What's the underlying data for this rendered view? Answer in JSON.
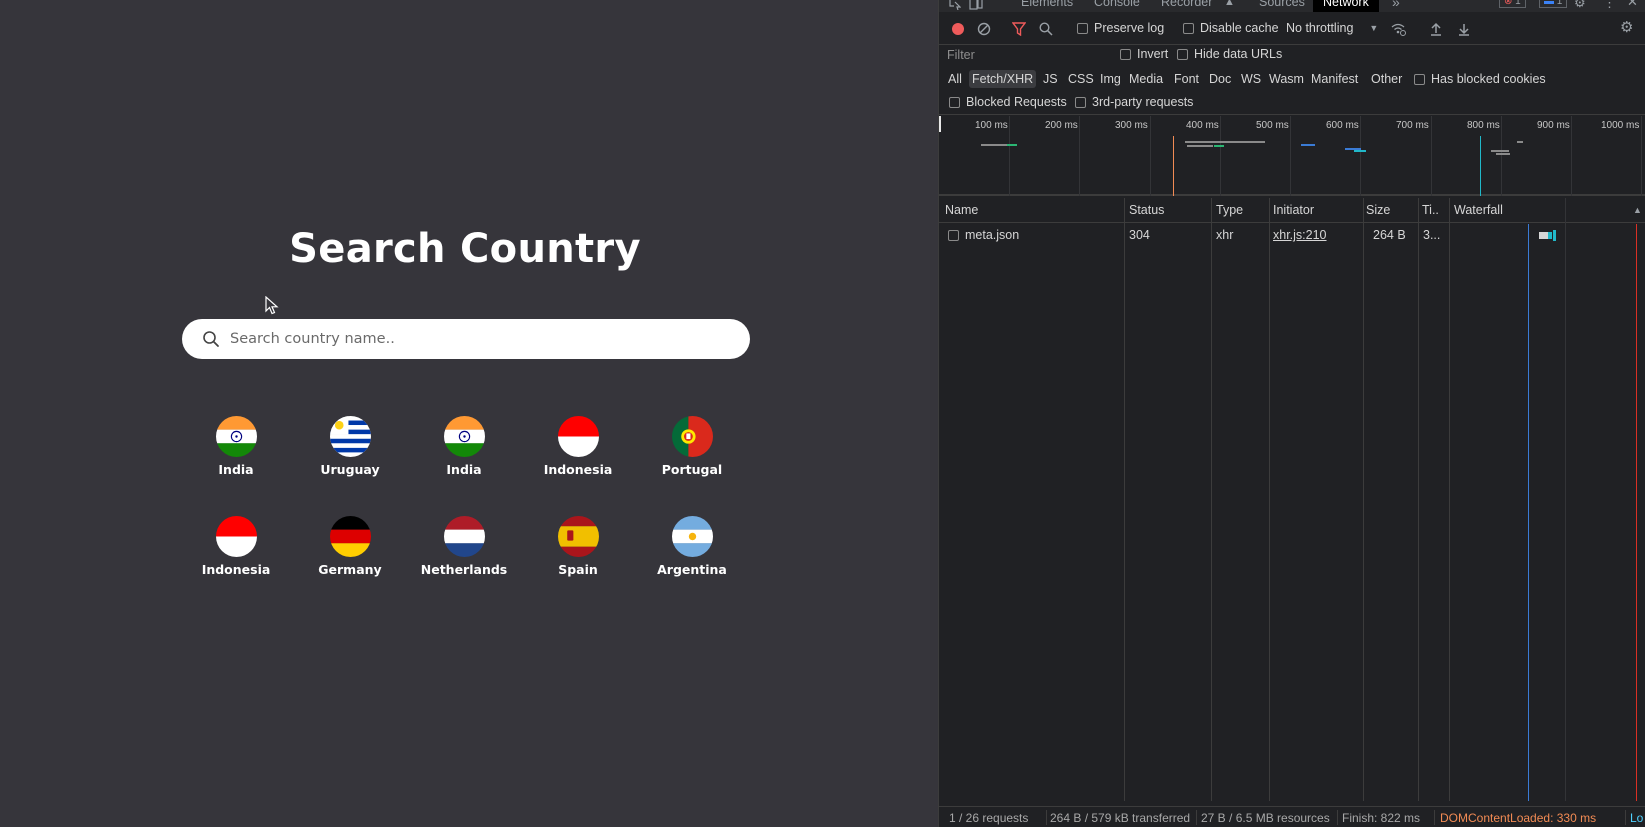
{
  "app": {
    "title": "Search Country",
    "search_placeholder": "Search country name..",
    "countries": [
      {
        "name": "India",
        "flag": "india-flag-icon"
      },
      {
        "name": "Uruguay",
        "flag": "uruguay-flag-icon"
      },
      {
        "name": "India",
        "flag": "india-flag-icon"
      },
      {
        "name": "Indonesia",
        "flag": "indonesia-flag-icon"
      },
      {
        "name": "Portugal",
        "flag": "portugal-flag-icon"
      },
      {
        "name": "Indonesia",
        "flag": "indonesia-flag-icon"
      },
      {
        "name": "Germany",
        "flag": "germany-flag-icon"
      },
      {
        "name": "Netherlands",
        "flag": "netherlands-flag-icon"
      },
      {
        "name": "Spain",
        "flag": "spain-flag-icon"
      },
      {
        "name": "Argentina",
        "flag": "argentina-flag-icon"
      }
    ]
  },
  "devtools": {
    "tabs": [
      "Elements",
      "Console",
      "Recorder",
      "Sources",
      "Network"
    ],
    "active_tab": "Network",
    "error_count": "1",
    "message_count": "1",
    "toolbar": {
      "preserve_log": "Preserve log",
      "disable_cache": "Disable cache",
      "throttling": "No throttling"
    },
    "filter": {
      "placeholder": "Filter",
      "invert": "Invert",
      "hide_data_urls": "Hide data URLs"
    },
    "resource_types": [
      "All",
      "Fetch/XHR",
      "JS",
      "CSS",
      "Img",
      "Media",
      "Font",
      "Doc",
      "WS",
      "Wasm",
      "Manifest",
      "Other"
    ],
    "active_type": "Fetch/XHR",
    "has_blocked_cookies": "Has blocked cookies",
    "blocked_requests": "Blocked Requests",
    "third_party": "3rd-party requests",
    "timeline_ticks": [
      "100 ms",
      "200 ms",
      "300 ms",
      "400 ms",
      "500 ms",
      "600 ms",
      "700 ms",
      "800 ms",
      "900 ms",
      "1000 ms"
    ],
    "columns": [
      "Name",
      "Status",
      "Type",
      "Initiator",
      "Size",
      "Ti..",
      "Waterfall"
    ],
    "requests": [
      {
        "name": "meta.json",
        "status": "304",
        "type": "xhr",
        "initiator": "xhr.js:210",
        "size": "264 B",
        "time": "3..."
      }
    ],
    "status_bar": {
      "requests": "1 / 26 requests",
      "transferred": "264 B / 579 kB transferred",
      "resources": "27 B / 6.5 MB resources",
      "finish": "Finish: 822 ms",
      "dom_content_loaded": "DOMContentLoaded: 330 ms",
      "load": "Lo"
    },
    "colors": {
      "dcl": "#f28b54",
      "load": "#4fd1ff",
      "record": "#ef5b5b",
      "accent": "#8ab4f8"
    }
  }
}
